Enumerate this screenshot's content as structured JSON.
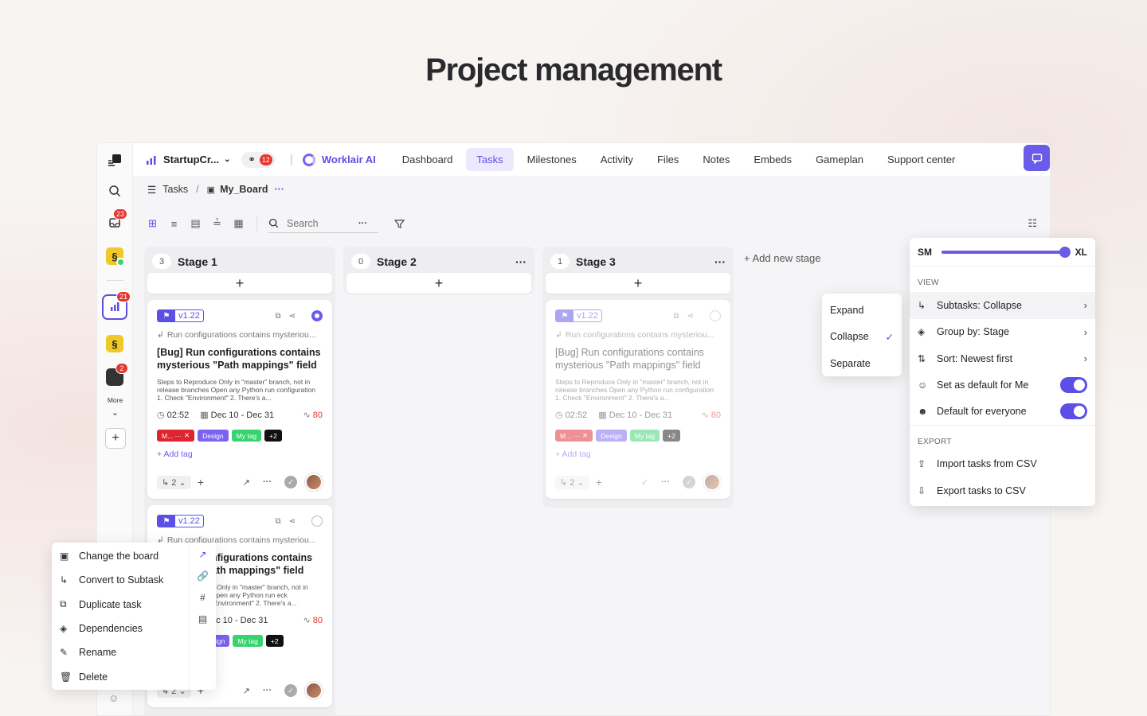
{
  "page_title": "Project management",
  "topbar": {
    "workspace": "StartupCr...",
    "notif_count": "12",
    "ai_label": "Worklair AI",
    "tabs": [
      "Dashboard",
      "Tasks",
      "Milestones",
      "Activity",
      "Files",
      "Notes",
      "Embeds",
      "Gameplan",
      "Support center"
    ],
    "active_tab": "Tasks"
  },
  "rail": {
    "inbox_badge": "23",
    "active_badge": "21",
    "ws3_badge": "2",
    "more_label": "More"
  },
  "breadcrumb": {
    "root": "Tasks",
    "separator": "/",
    "board": "My_Board"
  },
  "toolbar": {
    "search_placeholder": "Search"
  },
  "columns": [
    {
      "count": "3",
      "name": "Stage 1"
    },
    {
      "count": "0",
      "name": "Stage 2"
    },
    {
      "count": "1",
      "name": "Stage 3"
    }
  ],
  "add_stage": "+ Add new stage",
  "task": {
    "version": "v1.22",
    "parent": "Run configurations contains mysteriou...",
    "title": "[Bug] Run configurations contains mysterious \"Path mappings\" field",
    "description": "Steps to Reproduce Only in \"master\" branch, not in release branches Open any Python run configuration 1. Check \"Environment\" 2. There's a...",
    "time": "02:52",
    "dates": "Dec 10 - Dec 31",
    "score": "80",
    "tags": [
      "M... ···",
      "Design",
      "My tag",
      "+2"
    ],
    "add_tag": "+ Add tag",
    "subtasks": "2"
  },
  "card2_partial": {
    "parent": "Run configurations contains mysteriou...",
    "title_l1": "nfigurations contains",
    "title_l2": "ath mappings\" field",
    "desc": "e Only in \"master\" branch, not in Open any Python run eck \"Environment\" 2. There's a...",
    "dates": "ec 10 - Dec 31",
    "tag1": "ign"
  },
  "subtasks_menu": {
    "items": [
      "Expand",
      "Collapse",
      "Separate"
    ],
    "selected": "Collapse"
  },
  "view_panel": {
    "size_min": "SM",
    "size_max": "XL",
    "size_value": 1.0,
    "view_section": "VIEW",
    "view_items": [
      "Subtasks: Collapse",
      "Group by: Stage",
      "Sort: Newest first"
    ],
    "toggles": [
      {
        "label": "Set as default for Me",
        "on": true
      },
      {
        "label": "Default for everyone",
        "on": true
      }
    ],
    "export_section": "EXPORT",
    "export_items": [
      "Import tasks from CSV",
      "Export tasks to CSV"
    ]
  },
  "context_menu": {
    "items": [
      "Change the board",
      "Convert to Subtask",
      "Duplicate task",
      "Dependencies",
      "Rename",
      "Delete"
    ]
  },
  "colors": {
    "accent": "#5b4fe6",
    "tag_red": "#e0232e",
    "tag_purple": "#7a63f0",
    "tag_green": "#38d36e",
    "danger": "#e5362f"
  }
}
